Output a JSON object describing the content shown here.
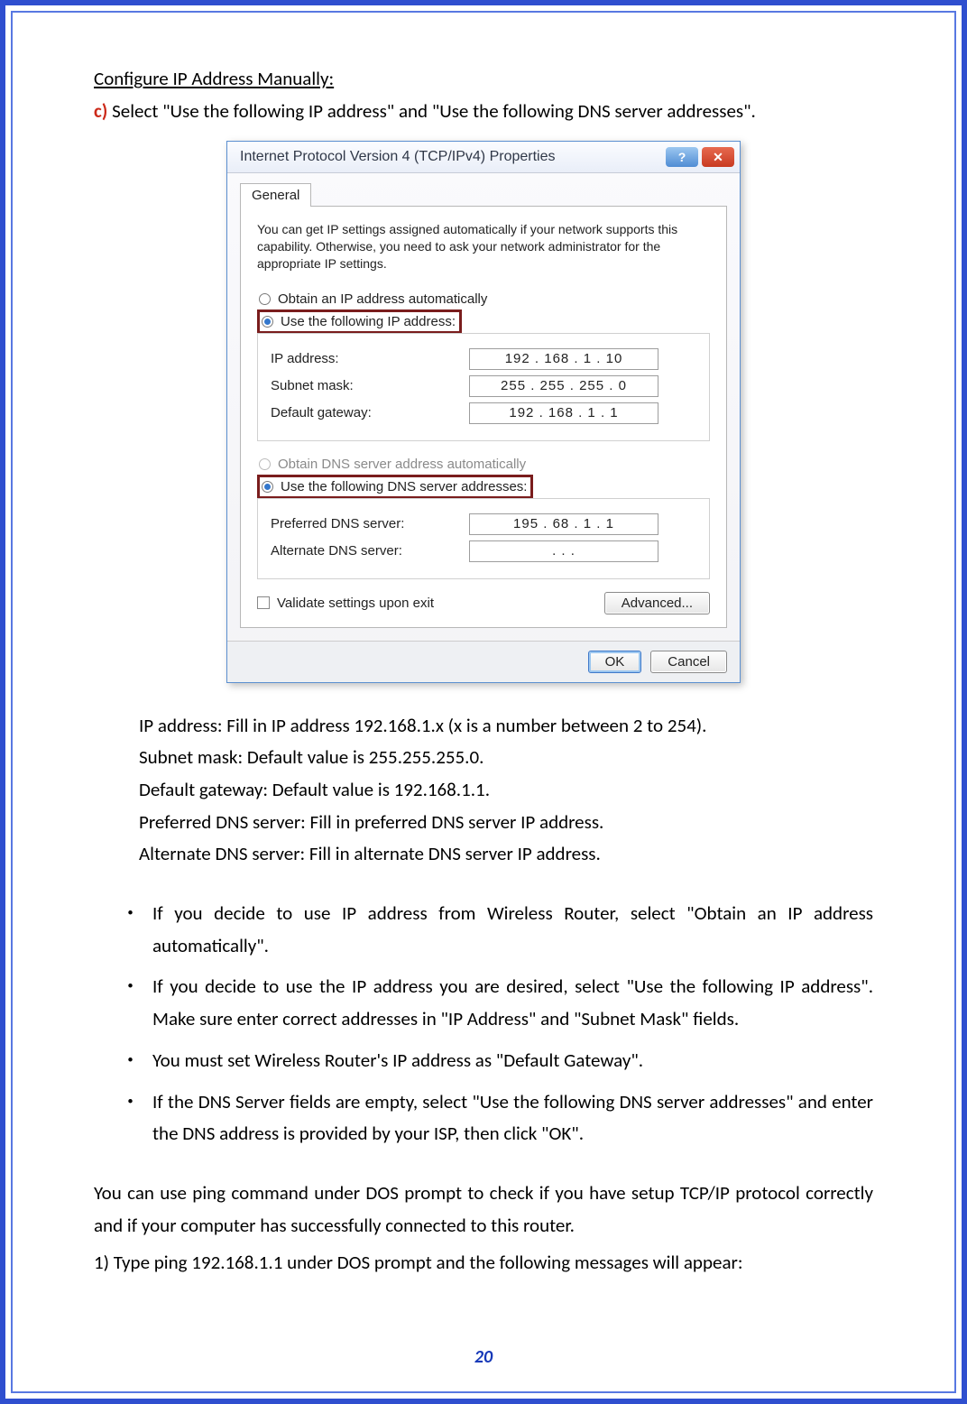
{
  "heading": "Configure IP Address Manually:",
  "step": {
    "marker": "c)",
    "text": " Select \"Use the following IP address\" and \"Use the following DNS server addresses\"."
  },
  "dialog": {
    "title": "Internet Protocol Version 4 (TCP/IPv4) Properties",
    "help_glyph": "?",
    "close_glyph": "✕",
    "tab_label": "General",
    "description": "You can get IP settings assigned automatically if your network supports this capability. Otherwise, you need to ask your network administrator for the appropriate IP settings.",
    "radio_obtain_ip": "Obtain an IP address automatically",
    "radio_use_ip": "Use the following IP address:",
    "fields": {
      "ip_label": "IP address:",
      "ip_value": "192 . 168 .  1  . 10",
      "subnet_label": "Subnet mask:",
      "subnet_value": "255 . 255 . 255 .  0",
      "gateway_label": "Default gateway:",
      "gateway_value": "192 . 168 .  1  .  1"
    },
    "radio_obtain_dns": "Obtain DNS server address automatically",
    "radio_use_dns": "Use the following DNS server addresses:",
    "dns": {
      "pref_label": "Preferred DNS server:",
      "pref_value": "195 . 68  .  1  .  1",
      "alt_label": "Alternate DNS server:",
      "alt_value": "   .       .       .   "
    },
    "validate_label": "Validate settings upon exit",
    "advanced_label": "Advanced...",
    "ok_label": "OK",
    "cancel_label": "Cancel"
  },
  "lines": {
    "l1": "IP address: Fill in IP address 192.168.1.x (x is a number between 2 to 254).",
    "l2": "Subnet mask: Default value is 255.255.255.0.",
    "l3": "Default gateway: Default value is 192.168.1.1.",
    "l4": "Preferred DNS server: Fill in preferred DNS server IP address.",
    "l5": "Alternate DNS server: Fill in alternate DNS server IP address."
  },
  "bullets": {
    "b1": "If you decide to use IP address from Wireless Router, select \"Obtain an IP address automatically\".",
    "b2": "If you decide to use the IP address you are desired, select \"Use the following IP address\". Make sure enter correct addresses in \"IP Address\" and \"Subnet Mask\" fields.",
    "b3": "You must set Wireless Router's IP address as \"Default Gateway\".",
    "b4": "If the DNS Server fields are empty, select \"Use the following DNS server addresses\" and enter the DNS address is provided by your ISP, then click \"OK\"."
  },
  "para1": "You can use ping command under DOS prompt to check if you have setup TCP/IP protocol correctly and if your computer has successfully connected to this router.",
  "num1": "1)   Type ping 192.168.1.1 under DOS prompt and the following messages will appear:",
  "page_number": "20"
}
